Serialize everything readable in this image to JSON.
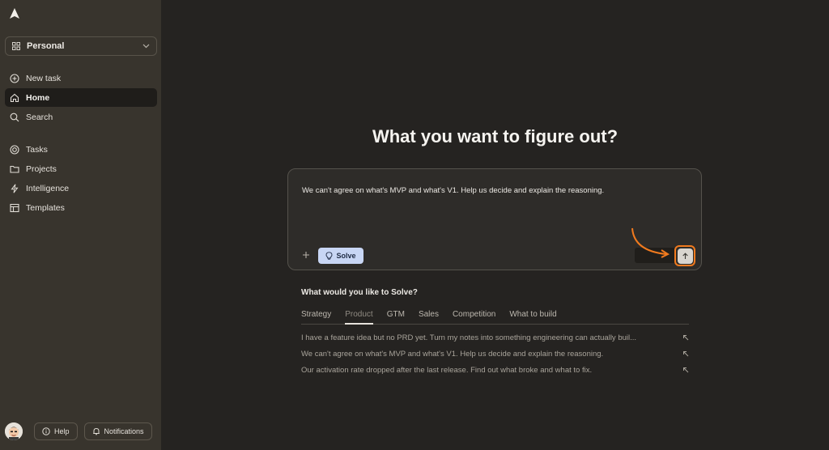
{
  "sidebar": {
    "workspace_label": "Personal",
    "nav_primary": [
      {
        "label": "New task",
        "icon": "plus-circle-icon"
      },
      {
        "label": "Home",
        "icon": "home-icon",
        "active": true
      },
      {
        "label": "Search",
        "icon": "search-icon"
      }
    ],
    "nav_secondary": [
      {
        "label": "Tasks",
        "icon": "target-icon"
      },
      {
        "label": "Projects",
        "icon": "folder-icon"
      },
      {
        "label": "Intelligence",
        "icon": "lightning-icon"
      },
      {
        "label": "Templates",
        "icon": "template-icon"
      }
    ],
    "help_label": "Help",
    "notifications_label": "Notifications"
  },
  "main": {
    "headline": "What you want to figure out?",
    "prompt_text": "We can't agree on what's MVP and what's V1. Help us decide and explain the reasoning.",
    "solve_label": "Solve",
    "suggest_title": "What would you like to Solve?",
    "tabs": [
      "Strategy",
      "Product",
      "GTM",
      "Sales",
      "Competition",
      "What to build"
    ],
    "active_tab": "Product",
    "suggestions": [
      "I have a feature idea but no PRD yet. Turn my notes into something engineering can actually buil...",
      "We can't agree on what's MVP and what's V1. Help us decide and explain the reasoning.",
      "Our activation rate dropped after the last release. Find out what broke and what to fix."
    ]
  },
  "colors": {
    "sidebar_bg": "#38342d",
    "main_bg": "#252321",
    "accent_orange": "#f07a1e",
    "solve_chip": "#c8d6f4"
  }
}
